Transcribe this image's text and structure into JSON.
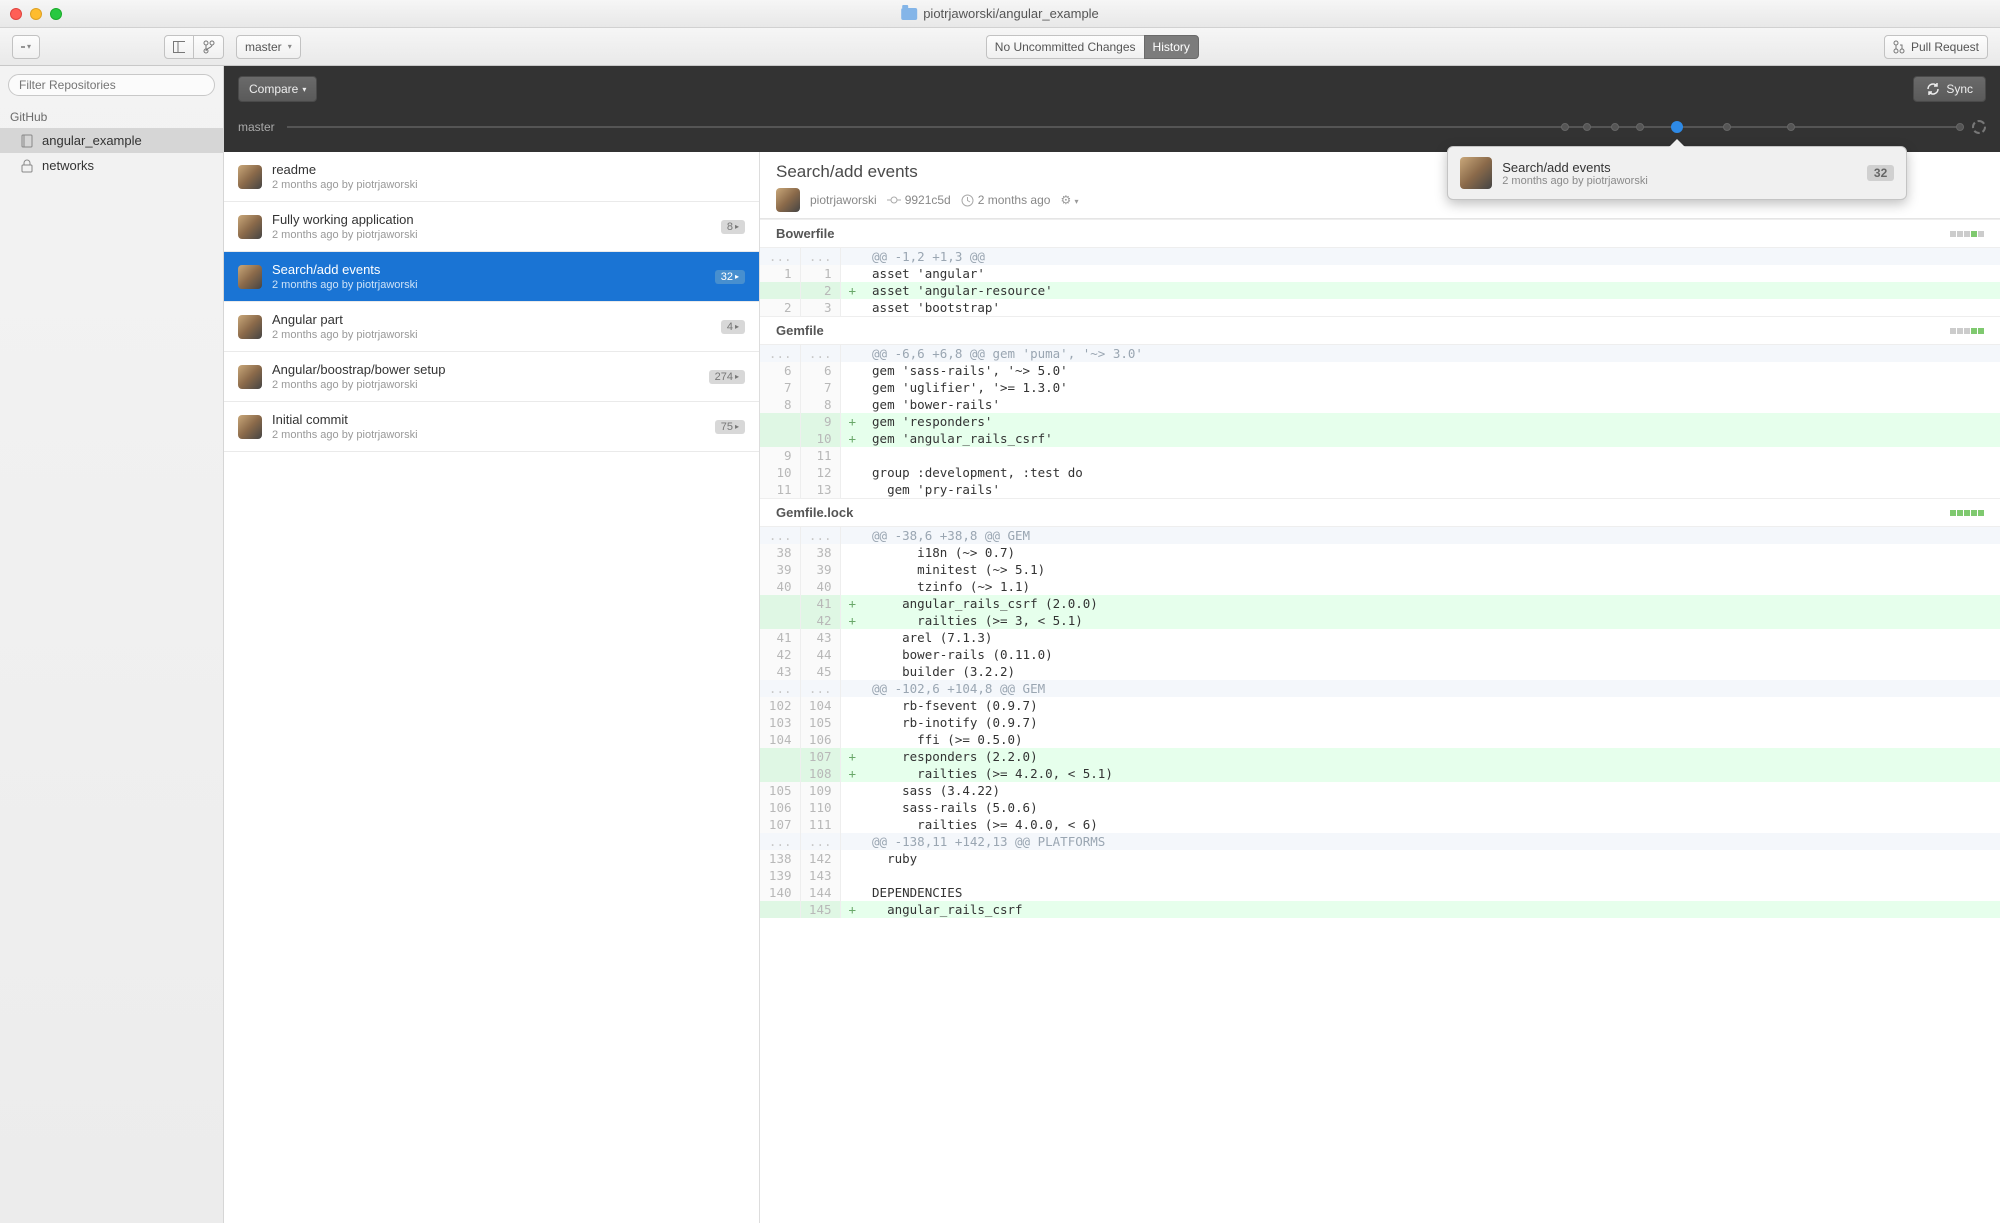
{
  "title_path": "piotrjaworski/angular_example",
  "toolbar": {
    "branch": "master",
    "no_uncommitted": "No Uncommitted Changes",
    "history": "History",
    "pull_request": "Pull Request"
  },
  "sidebar": {
    "filter_placeholder": "Filter Repositories",
    "group": "GitHub",
    "repos": [
      {
        "name": "angular_example",
        "icon": "repo"
      },
      {
        "name": "networks",
        "icon": "lock"
      }
    ],
    "active_index": 0
  },
  "darkband": {
    "compare": "Compare",
    "sync": "Sync",
    "branch": "master"
  },
  "timeline": {
    "dots": [
      76.4,
      77.7,
      79.4,
      80.9,
      83.1,
      86.1,
      89.9,
      100
    ],
    "active_index": 4,
    "popover": {
      "title": "Search/add events",
      "sub": "2 months ago by piotrjaworski",
      "count": "32"
    }
  },
  "commits": [
    {
      "title": "readme",
      "sub": "2 months ago by piotrjaworski",
      "count": null
    },
    {
      "title": "Fully working application",
      "sub": "2 months ago by piotrjaworski",
      "count": "8"
    },
    {
      "title": "Search/add events",
      "sub": "2 months ago by piotrjaworski",
      "count": "32"
    },
    {
      "title": "Angular part",
      "sub": "2 months ago by piotrjaworski",
      "count": "4"
    },
    {
      "title": "Angular/boostrap/bower setup",
      "sub": "2 months ago by piotrjaworski",
      "count": "274"
    },
    {
      "title": "Initial commit",
      "sub": "2 months ago by piotrjaworski",
      "count": "75"
    }
  ],
  "selected_commit_index": 2,
  "commit_detail": {
    "title": "Search/add events",
    "author": "piotrjaworski",
    "sha": "9921c5d",
    "time": "2 months ago"
  },
  "files": [
    {
      "name": "Bowerfile",
      "indicator": [
        0,
        0,
        0,
        1,
        0
      ],
      "lines": [
        {
          "type": "hunk",
          "old": "...",
          "new": "...",
          "text": "@@ -1,2 +1,3 @@"
        },
        {
          "type": "ctx",
          "old": "1",
          "new": "1",
          "text": "asset 'angular'"
        },
        {
          "type": "add",
          "old": "",
          "new": "2",
          "text": "asset 'angular-resource'"
        },
        {
          "type": "ctx",
          "old": "2",
          "new": "3",
          "text": "asset 'bootstrap'"
        }
      ]
    },
    {
      "name": "Gemfile",
      "indicator": [
        0,
        0,
        0,
        1,
        1
      ],
      "lines": [
        {
          "type": "hunk",
          "old": "...",
          "new": "...",
          "text": "@@ -6,6 +6,8 @@ gem 'puma', '~> 3.0'"
        },
        {
          "type": "ctx",
          "old": "6",
          "new": "6",
          "text": "gem 'sass-rails', '~> 5.0'"
        },
        {
          "type": "ctx",
          "old": "7",
          "new": "7",
          "text": "gem 'uglifier', '>= 1.3.0'"
        },
        {
          "type": "ctx",
          "old": "8",
          "new": "8",
          "text": "gem 'bower-rails'"
        },
        {
          "type": "add",
          "old": "",
          "new": "9",
          "text": "gem 'responders'"
        },
        {
          "type": "add",
          "old": "",
          "new": "10",
          "text": "gem 'angular_rails_csrf'"
        },
        {
          "type": "ctx",
          "old": "9",
          "new": "11",
          "text": ""
        },
        {
          "type": "ctx",
          "old": "10",
          "new": "12",
          "text": "group :development, :test do"
        },
        {
          "type": "ctx",
          "old": "11",
          "new": "13",
          "text": "  gem 'pry-rails'"
        }
      ]
    },
    {
      "name": "Gemfile.lock",
      "indicator": [
        1,
        1,
        1,
        1,
        1
      ],
      "lines": [
        {
          "type": "hunk",
          "old": "...",
          "new": "...",
          "text": "@@ -38,6 +38,8 @@ GEM"
        },
        {
          "type": "ctx",
          "old": "38",
          "new": "38",
          "text": "      i18n (~> 0.7)"
        },
        {
          "type": "ctx",
          "old": "39",
          "new": "39",
          "text": "      minitest (~> 5.1)"
        },
        {
          "type": "ctx",
          "old": "40",
          "new": "40",
          "text": "      tzinfo (~> 1.1)"
        },
        {
          "type": "add",
          "old": "",
          "new": "41",
          "text": "    angular_rails_csrf (2.0.0)"
        },
        {
          "type": "add",
          "old": "",
          "new": "42",
          "text": "      railties (>= 3, < 5.1)"
        },
        {
          "type": "ctx",
          "old": "41",
          "new": "43",
          "text": "    arel (7.1.3)"
        },
        {
          "type": "ctx",
          "old": "42",
          "new": "44",
          "text": "    bower-rails (0.11.0)"
        },
        {
          "type": "ctx",
          "old": "43",
          "new": "45",
          "text": "    builder (3.2.2)"
        },
        {
          "type": "hunk",
          "old": "...",
          "new": "...",
          "text": "@@ -102,6 +104,8 @@ GEM"
        },
        {
          "type": "ctx",
          "old": "102",
          "new": "104",
          "text": "    rb-fsevent (0.9.7)"
        },
        {
          "type": "ctx",
          "old": "103",
          "new": "105",
          "text": "    rb-inotify (0.9.7)"
        },
        {
          "type": "ctx",
          "old": "104",
          "new": "106",
          "text": "      ffi (>= 0.5.0)"
        },
        {
          "type": "add",
          "old": "",
          "new": "107",
          "text": "    responders (2.2.0)"
        },
        {
          "type": "add",
          "old": "",
          "new": "108",
          "text": "      railties (>= 4.2.0, < 5.1)"
        },
        {
          "type": "ctx",
          "old": "105",
          "new": "109",
          "text": "    sass (3.4.22)"
        },
        {
          "type": "ctx",
          "old": "106",
          "new": "110",
          "text": "    sass-rails (5.0.6)"
        },
        {
          "type": "ctx",
          "old": "107",
          "new": "111",
          "text": "      railties (>= 4.0.0, < 6)"
        },
        {
          "type": "hunk",
          "old": "...",
          "new": "...",
          "text": "@@ -138,11 +142,13 @@ PLATFORMS"
        },
        {
          "type": "ctx",
          "old": "138",
          "new": "142",
          "text": "  ruby"
        },
        {
          "type": "ctx",
          "old": "139",
          "new": "143",
          "text": ""
        },
        {
          "type": "ctx",
          "old": "140",
          "new": "144",
          "text": "DEPENDENCIES"
        },
        {
          "type": "add",
          "old": "",
          "new": "145",
          "text": "  angular_rails_csrf"
        }
      ]
    }
  ]
}
